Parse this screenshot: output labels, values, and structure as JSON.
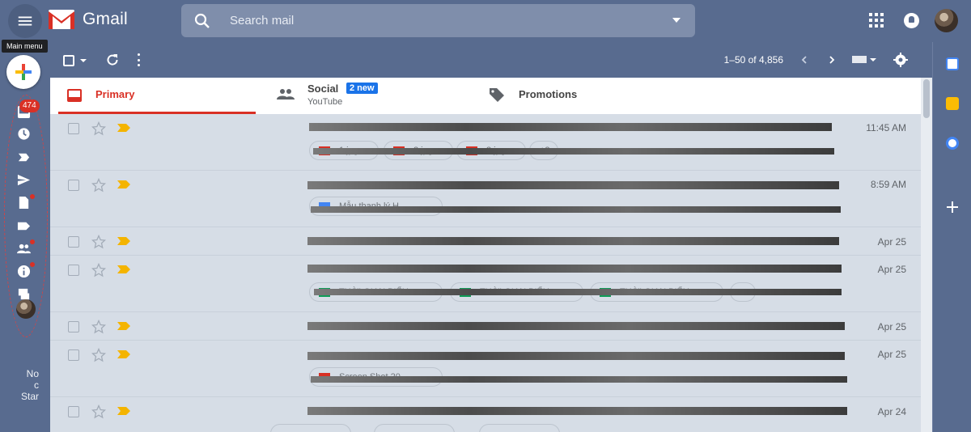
{
  "app": {
    "name": "Gmail"
  },
  "header": {
    "menu_tooltip": "Main menu",
    "search_placeholder": "Search mail"
  },
  "rail": {
    "inbox_badge": "474",
    "footer_note": "No\nc\nStar"
  },
  "toolbar": {
    "pagination": "1–50 of 4,856"
  },
  "tabs": [
    {
      "label": "Primary",
      "icon": "inbox-icon",
      "selected": true
    },
    {
      "label": "Social",
      "badge": "2 new",
      "subtitle": "YouTube",
      "icon": "people-icon"
    },
    {
      "label": "Promotions",
      "icon": "tag-icon"
    }
  ],
  "emails": [
    {
      "time": "11:45 AM",
      "attachments": [
        {
          "icon": "pdf-icon",
          "label": "1.jpg"
        },
        {
          "icon": "pdf-icon",
          "label": "2.jpg"
        },
        {
          "icon": "pdf-icon",
          "label": "3.jpg"
        },
        {
          "icon": "more",
          "label": "+2"
        }
      ]
    },
    {
      "time": "8:59 AM",
      "attachments": [
        {
          "icon": "doc-icon",
          "label": "Mẫu thanh lý H..."
        }
      ]
    },
    {
      "time": "Apr 25",
      "attachments": []
    },
    {
      "time": "Apr 25",
      "attachments": [
        {
          "icon": "sheet-icon",
          "label": "THỜI GIAN BIỂU..."
        },
        {
          "icon": "sheet-icon",
          "label": "THỜI GIAN BIỂU..."
        },
        {
          "icon": "sheet-icon",
          "label": "THỜI GIAN BIỂU..."
        },
        {
          "icon": "more",
          "label": ""
        }
      ]
    },
    {
      "time": "Apr 25",
      "attachments": []
    },
    {
      "time": "Apr 25",
      "attachments": [
        {
          "icon": "pdf-icon",
          "label": "Screen Shot 20..."
        }
      ]
    },
    {
      "time": "Apr 24",
      "attachments": []
    }
  ],
  "colors": {
    "background": "#586b8f",
    "accent_red": "#d93025",
    "badge_blue": "#1a73e8",
    "important_yellow": "#f4b400"
  }
}
